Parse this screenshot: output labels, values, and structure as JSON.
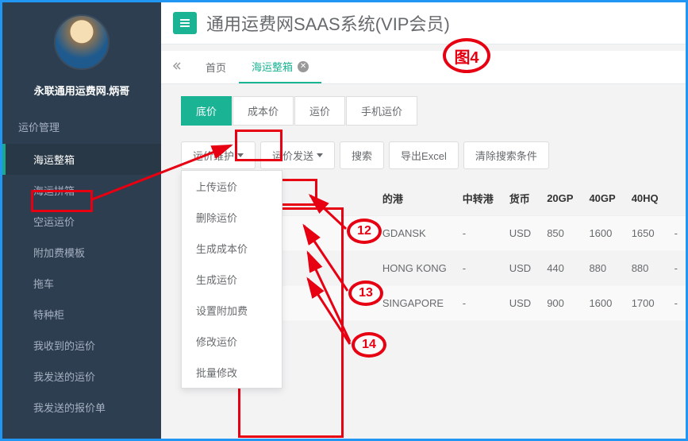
{
  "username": "永联通用运费网.炳哥",
  "pageTitle": "通用运费网SAAS系统(VIP会员)",
  "navSection": "运价管理",
  "navItems": [
    {
      "label": "海运整箱",
      "active": true
    },
    {
      "label": "海运拼箱",
      "active": false
    },
    {
      "label": "空运运价",
      "active": false
    },
    {
      "label": "附加费模板",
      "active": false
    },
    {
      "label": "拖车",
      "active": false
    },
    {
      "label": "特种柜",
      "active": false
    },
    {
      "label": "我收到的运价",
      "active": false
    },
    {
      "label": "我发送的运价",
      "active": false
    },
    {
      "label": "我发送的报价单",
      "active": false
    }
  ],
  "tabs": {
    "home": "首页",
    "active": "海运整箱"
  },
  "priceTabs": [
    {
      "label": "底价",
      "active": true
    },
    {
      "label": "成本价",
      "active": false
    },
    {
      "label": "运价",
      "active": false
    },
    {
      "label": "手机运价",
      "active": false
    }
  ],
  "toolbar": {
    "maintain": "运价维护",
    "send": "运价发送",
    "search": "搜索",
    "export": "导出Excel",
    "clear": "清除搜索条件"
  },
  "dropdown": [
    "上传运价",
    "删除运价",
    "生成成本价",
    "生成运价",
    "设置附加费",
    "修改运价",
    "批量修改"
  ],
  "tableHeaders": {
    "port": "的港",
    "trans": "中转港",
    "curr": "货币",
    "gp20": "20GP",
    "gp40": "40GP",
    "hq40": "40HQ"
  },
  "rows": [
    {
      "port": "GDANSK",
      "trans": "-",
      "curr": "USD",
      "gp20": "850",
      "gp40": "1600",
      "hq40": "1650",
      "dash": "-"
    },
    {
      "port": "HONG KONG",
      "trans": "-",
      "curr": "USD",
      "gp20": "440",
      "gp40": "880",
      "hq40": "880",
      "dash": "-"
    },
    {
      "port": "SINGAPORE",
      "trans": "-",
      "curr": "USD",
      "gp20": "900",
      "gp40": "1600",
      "hq40": "1700",
      "dash": "-"
    }
  ],
  "annotations": {
    "fig": "图4",
    "n12": "12",
    "n13": "13",
    "n14": "14"
  }
}
